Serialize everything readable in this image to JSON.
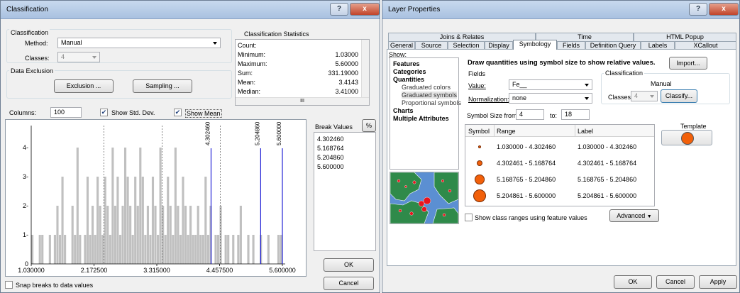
{
  "classification": {
    "title": "Classification",
    "help_label": "?",
    "close_label": "x",
    "group_label": "Classification",
    "method_label": "Method:",
    "method_value": "Manual",
    "classes_label": "Classes:",
    "classes_value": "4",
    "data_exclusion_label": "Data Exclusion",
    "exclusion_button": "Exclusion ...",
    "sampling_button": "Sampling ...",
    "stats": {
      "title": "Classification Statistics",
      "rows": [
        {
          "label": "Count:",
          "value": ""
        },
        {
          "label": "Minimum:",
          "value": "1.03000"
        },
        {
          "label": "Maximum:",
          "value": "5.60000"
        },
        {
          "label": "Sum:",
          "value": "331.19000"
        },
        {
          "label": "Mean:",
          "value": "3.4143"
        },
        {
          "label": "Median:",
          "value": "3.41000"
        }
      ],
      "scroll_mid": "III"
    },
    "columns_label": "Columns:",
    "columns_value": "100",
    "show_std_dev_label": "Show Std. Dev.",
    "show_mean_label": "Show Mean",
    "show_std_dev_checked": true,
    "show_mean_checked": true,
    "histogram": {
      "y_ticks": [
        "0",
        "1-",
        "2-",
        "3-",
        "4-"
      ],
      "x_ticks": [
        "1.030000",
        "2.172500",
        "3.315000",
        "4.457500",
        "5.600000"
      ],
      "break_labels": [
        "4.302460",
        "5.204860",
        "5.600000"
      ]
    },
    "break_values_label": "Break Values",
    "percent_button": "%",
    "break_values": [
      "4.302460",
      "5.168764",
      "5.204860",
      "5.600000"
    ],
    "ok_button": "OK",
    "cancel_button": "Cancel",
    "snap_label": "Snap breaks to data values",
    "snap_checked": false
  },
  "layer_properties": {
    "title": "Layer Properties",
    "help_label": "?",
    "close_label": "x",
    "tabs_row1": [
      "Joins & Relates",
      "Time",
      "HTML Popup"
    ],
    "tabs_row2": [
      "General",
      "Source",
      "Selection",
      "Display",
      "Symbology",
      "Fields",
      "Definition Query",
      "Labels",
      "XCallout"
    ],
    "selected_tab": "Symbology",
    "show_label": "Show:",
    "show_items": [
      {
        "text": "Features",
        "level": 0
      },
      {
        "text": "Categories",
        "level": 0
      },
      {
        "text": "Quantities",
        "level": 0
      },
      {
        "text": "Graduated colors",
        "level": 1
      },
      {
        "text": "Graduated symbols",
        "level": 1
      },
      {
        "text": "Proportional symbols",
        "level": 1
      },
      {
        "text": "Charts",
        "level": 0
      },
      {
        "text": "Multiple Attributes",
        "level": 0
      }
    ],
    "heading": "Draw quantities using symbol size to show relative values.",
    "import_button": "Import...",
    "fields_group": "Fields",
    "value_label": "Value:",
    "value_value": "Fe__",
    "normalization_label": "Normalization:",
    "normalization_value": "none",
    "classification_group": "Classification",
    "classification_method": "Manual",
    "classes_label": "Classes:",
    "classes_value": "4",
    "classify_button": "Classify...",
    "symbol_size_from_label": "Symbol Size from:",
    "symbol_size_from": "4",
    "to_label": "to:",
    "symbol_size_to": "18",
    "template_label": "Template",
    "template_color": "#f2600a",
    "table_headers": [
      "Symbol",
      "Range",
      "Label"
    ],
    "rows": [
      {
        "range": "1.030000 - 4.302460",
        "label": "1.030000 - 4.302460"
      },
      {
        "range": "4.302461 - 5.168764",
        "label": "4.302461 - 5.168764"
      },
      {
        "range": "5.168765 - 5.204860",
        "label": "5.168765 - 5.204860"
      },
      {
        "range": "5.204861 - 5.600000",
        "label": "5.204861 - 5.600000"
      }
    ],
    "show_class_ranges_label": "Show class ranges using feature values",
    "show_class_ranges_checked": false,
    "advanced_button": "Advanced",
    "ok_button": "OK",
    "cancel_button": "Cancel",
    "apply_button": "Apply"
  },
  "colors": {
    "histogram_bar": "#c0c0c0",
    "break_line": "#2323d6",
    "symbol_fill": "#f2600a",
    "map_water": "#5b8fd2",
    "map_land": "#2f8a4a"
  }
}
